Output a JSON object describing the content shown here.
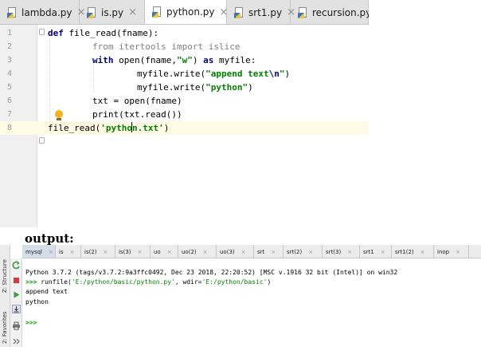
{
  "editor_tabs": [
    {
      "label": "lambda.py",
      "active": false
    },
    {
      "label": "is.py",
      "active": false
    },
    {
      "label": "python.py",
      "active": true
    },
    {
      "label": "srt1.py",
      "active": false
    },
    {
      "label": "recursion.py",
      "active": false
    }
  ],
  "tab_close_glyph": "×",
  "editor": {
    "line_numbers": [
      "1",
      "2",
      "3",
      "4",
      "5",
      "6",
      "7",
      "8"
    ],
    "current_line": "8",
    "code": {
      "l1_kw": "def",
      "l1_rest": " file_read(fname):",
      "l2_kw1": "from",
      "l2_mid": " itertools ",
      "l2_kw2": "import",
      "l2_rest": " islice",
      "l3_kw": "with",
      "l3_a": " open(fname,",
      "l3_str": "\"w\"",
      "l3_b": ") ",
      "l3_kw2": "as",
      "l3_c": " myfile:",
      "l4_a": "myfile.write(",
      "l4_str1": "\"append text",
      "l4_esc": "\\n",
      "l4_str2": "\"",
      "l4_b": ")",
      "l5_a": "myfile.write(",
      "l5_str": "\"python\"",
      "l5_b": ")",
      "l6_a": "txt = open(fname)",
      "l7_a": "print(txt.read())",
      "l8_a": "file_read(",
      "l8_str1": "'pytho",
      "l8_str2": "n.txt'",
      "l8_b": ")"
    }
  },
  "output_heading": "output:",
  "console_tabs": [
    {
      "label": "mysql",
      "active": true
    },
    {
      "label": "is",
      "active": false
    },
    {
      "label": "is(2)",
      "active": false
    },
    {
      "label": "is(3)",
      "active": false
    },
    {
      "label": "uo",
      "active": false
    },
    {
      "label": "uo(2)",
      "active": false
    },
    {
      "label": "uo(3)",
      "active": false
    },
    {
      "label": "srt",
      "active": false
    },
    {
      "label": "srt(2)",
      "active": false
    },
    {
      "label": "srt(3)",
      "active": false
    },
    {
      "label": "srt1",
      "active": false
    },
    {
      "label": "srt1(2)",
      "active": false
    },
    {
      "label": "inop",
      "active": false
    }
  ],
  "side_labels": {
    "structure": "Z: Structure",
    "favorites": "2: Favorites"
  },
  "console": {
    "banner": "Python 3.7.2 (tags/v3.7.2:9a3ffc0492, Dec 23 2018, 22:20:52) [MSC v.1916 32 bit (Intel)] on win32",
    "prompt": ">>>",
    "runfile_a": " runfile(",
    "runfile_path": "'E:/python/basic/python.py'",
    "runfile_b": ", wdir=",
    "runfile_dir": "'E:/python/basic'",
    "runfile_c": ")",
    "out1": "append text",
    "out2": "python",
    "final_prompt": ">>>"
  },
  "colors": {
    "keyword": "#000080",
    "string": "#008000",
    "current_line": "#fffae3",
    "prompt": "#00a000"
  }
}
